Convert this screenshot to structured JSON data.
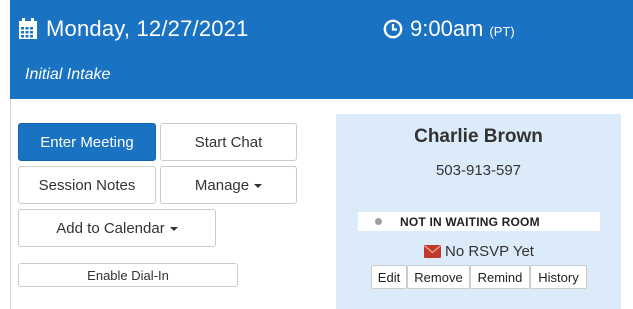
{
  "header": {
    "date": "Monday, 12/27/2021",
    "time": "9:00am",
    "timezone": "(PT)",
    "meeting_type": "Initial Intake",
    "background_color": "#1a72c2"
  },
  "actions": {
    "enter_meeting": "Enter Meeting",
    "start_chat": "Start Chat",
    "session_notes": "Session Notes",
    "manage": "Manage",
    "add_to_calendar": "Add to Calendar",
    "enable_dial_in": "Enable Dial-In"
  },
  "participant": {
    "name": "Charlie Brown",
    "phone": "503-913-597",
    "status": "NOT IN WAITING ROOM",
    "rsvp": "No RSVP Yet",
    "buttons": {
      "edit": "Edit",
      "remove": "Remove",
      "remind": "Remind",
      "history": "History"
    },
    "panel_color": "#dcebf9",
    "rsvp_icon_color": "#c0392b"
  }
}
